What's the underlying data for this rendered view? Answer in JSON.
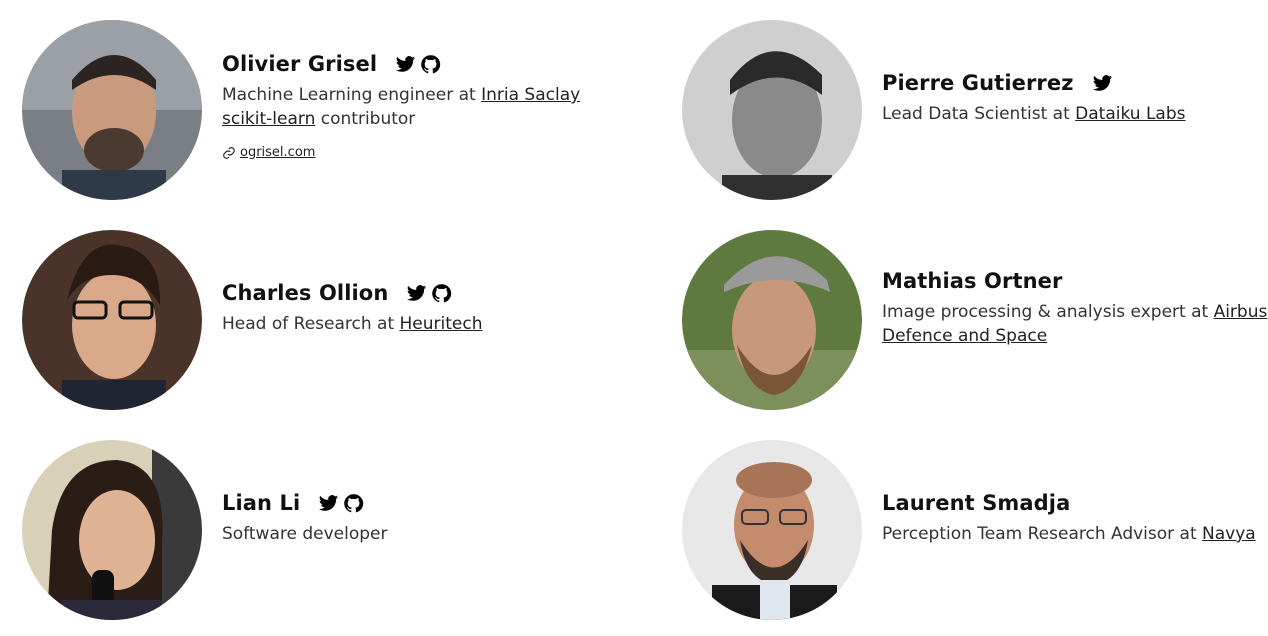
{
  "people": [
    {
      "name": "Olivier Grisel",
      "line1_prefix": "Machine Learning engineer at ",
      "line1_link": "Inria Saclay",
      "line2_link": "scikit-learn",
      "line2_suffix": " contributor",
      "website": "ogrisel.com",
      "icons": [
        "twitter-icon",
        "github-icon"
      ]
    },
    {
      "name": "Pierre Gutierrez",
      "line1_prefix": "Lead Data Scientist at ",
      "line1_link": "Dataiku Labs",
      "icons": [
        "twitter-icon"
      ]
    },
    {
      "name": "Charles Ollion",
      "line1_prefix": "Head of Research at ",
      "line1_link": "Heuritech",
      "icons": [
        "twitter-icon",
        "github-icon"
      ]
    },
    {
      "name": "Mathias Ortner",
      "line1_prefix": "Image processing & analysis expert at ",
      "line1_link": "Airbus",
      "line2_link": "Defence and Space",
      "icons": []
    },
    {
      "name": "Lian Li",
      "line1_prefix": "Software developer",
      "icons": [
        "twitter-icon",
        "github-icon"
      ]
    },
    {
      "name": "Laurent Smadja",
      "line1_prefix": "Perception Team Research Advisor at ",
      "line1_link": "Navya",
      "icons": []
    }
  ],
  "colors": {
    "text": "#222222",
    "icon": "#000000"
  }
}
